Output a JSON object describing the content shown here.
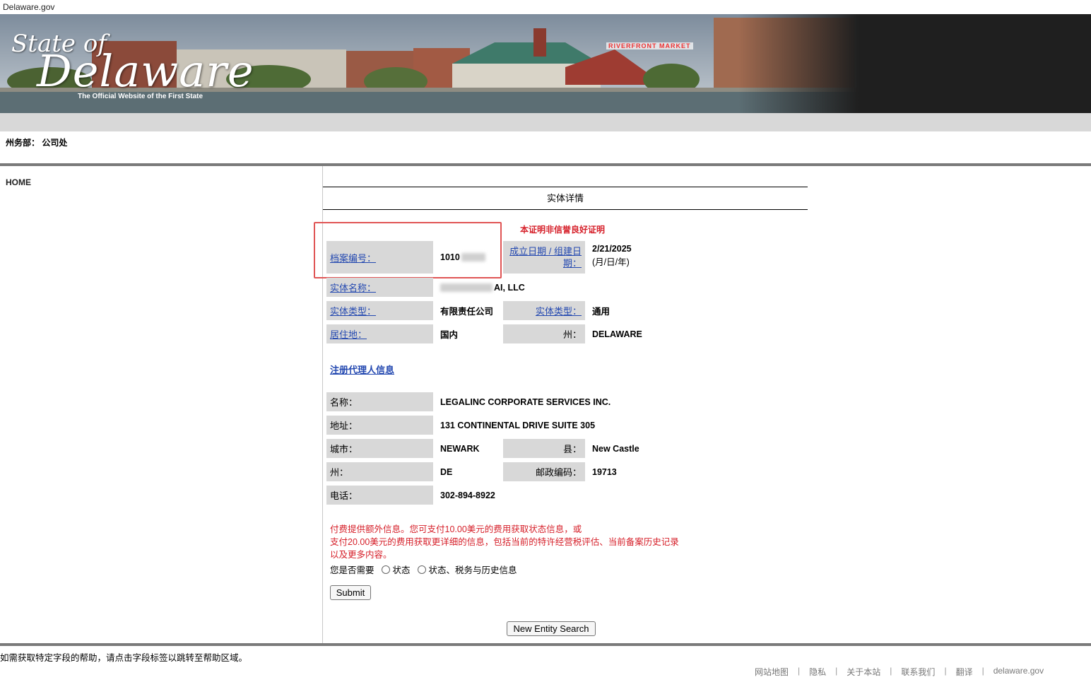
{
  "top": {
    "domain": "Delaware.gov"
  },
  "banner": {
    "logo_state": "State of",
    "logo_name": "Delaware",
    "tagline": "The Official Website of the First State",
    "market_sign": "RIVERFRONT MARKET"
  },
  "header": {
    "department": "州务部： 公司处"
  },
  "nav": {
    "home": "HOME"
  },
  "detail": {
    "title": "实体详情",
    "notice": "本证明非信誉良好证明",
    "file_number_label": "档案编号：",
    "file_number_value": "1010",
    "formation_date_label": "成立日期 / 组建日期：",
    "formation_date_value": "2/21/2025",
    "formation_date_format": "(月/日/年)",
    "entity_name_label": "实体名称：",
    "entity_name_value": "AI, LLC",
    "entity_kind_label": "实体类型：",
    "entity_kind_value": "有限责任公司",
    "entity_type_label": "实体类型：",
    "entity_type_value": "通用",
    "residency_label": "居住地：",
    "residency_value": "国内",
    "state_label": "州：",
    "state_value": "DELAWARE"
  },
  "agent": {
    "section_title": "注册代理人信息",
    "name_label": "名称：",
    "name_value": "LEGALINC CORPORATE SERVICES INC.",
    "address_label": "地址：",
    "address_value": "131 CONTINENTAL DRIVE SUITE 305",
    "city_label": "城市：",
    "city_value": "NEWARK",
    "county_label": "县：",
    "county_value": "New Castle",
    "state_label": "州：",
    "state_value": "DE",
    "zip_label": "邮政编码：",
    "zip_value": "19713",
    "phone_label": "电话：",
    "phone_value": "302-894-8922"
  },
  "paid": {
    "line1": "付费提供额外信息。您可支付10.00美元的费用获取状态信息，或",
    "line2": "支付20.00美元的费用获取更详细的信息，包括当前的特许经营税评估、当前备案历史记录",
    "line3": "以及更多内容。",
    "question": "您是否需要",
    "option_status": "状态",
    "option_full": "状态、税务与历史信息",
    "submit_label": "Submit"
  },
  "new_search_label": "New Entity Search",
  "help_text": "如需获取特定字段的帮助，请点击字段标签以跳转至帮助区域。",
  "footer": {
    "links": [
      "网站地图",
      "隐私",
      "关于本站",
      "联系我们",
      "翻译",
      "delaware.gov"
    ]
  }
}
